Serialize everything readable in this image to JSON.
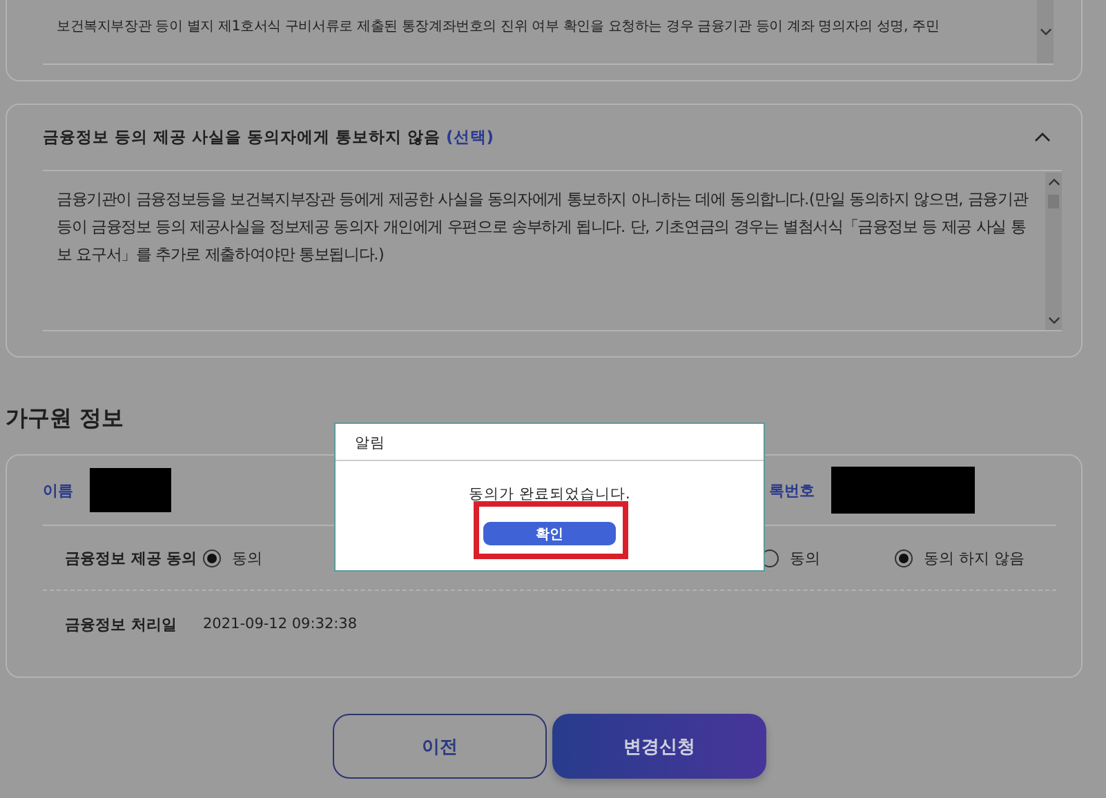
{
  "top_panel": {
    "lines": [
      "보건복지부장관 등이 별지 제1호서식 구비서류로 제출된 통장계좌번호의 진위 여부 확인을 요청하는 경우 금융기관 등이 계좌 명의자의 성명, 주민"
    ]
  },
  "notice_panel": {
    "title": "금융정보 등의 제공 사실을 동의자에게 통보하지 않음",
    "tag": "(선택)",
    "expanded": true,
    "paragraph": "금융기관이 금융정보등을 보건복지부장관 등에게 제공한 사실을 동의자에게 통보하지 아니하는 데에 동의합니다.(만일 동의하지 않으면, 금융기관 등이 금융정보 등의 제공사실을 정보제공 동의자 개인에게 우편으로 송부하게 됩니다. 단, 기초연금의 경우는 별첨서식「금융정보 등 제공 사실 통보 요구서」를 추가로 제출하여야만 통보됩니다.)"
  },
  "section_title": "가구원 정보",
  "member": {
    "name_label": "이름",
    "id_label": "록번호",
    "consent_label": "금융정보 제공 동의",
    "consent_options": [
      {
        "label": "동의",
        "selected": true
      }
    ],
    "second_options": [
      {
        "label": "동의",
        "selected": false
      },
      {
        "label": "동의 하지 않음",
        "selected": true
      }
    ],
    "date_label": "금융정보 처리일",
    "date": "2021-09-12 09:32:38"
  },
  "buttons": [
    {
      "label": "이전",
      "kind": "outline"
    },
    {
      "label": "변경신청",
      "kind": "primary"
    }
  ],
  "dialog": {
    "title": "알림",
    "message": "동의가 완료되었습니다.",
    "button": "확인",
    "highlighted": true
  }
}
